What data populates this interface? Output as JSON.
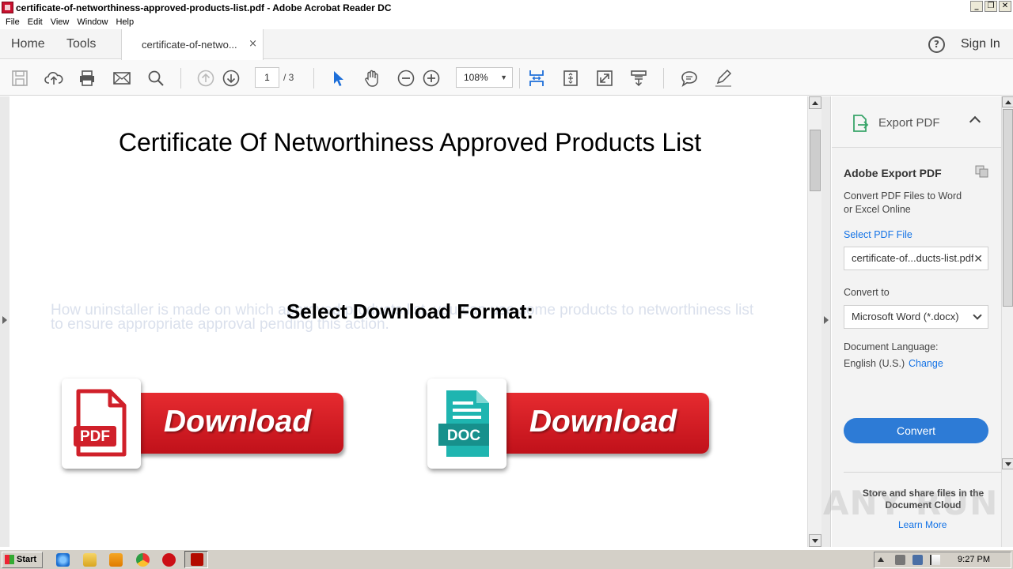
{
  "window": {
    "title": "certificate-of-networthiness-approved-products-list.pdf - Adobe Acrobat Reader DC",
    "buttons": [
      "_",
      "❐",
      "✕"
    ]
  },
  "menu": [
    "File",
    "Edit",
    "View",
    "Window",
    "Help"
  ],
  "tabs": {
    "home": "Home",
    "tools": "Tools",
    "document": "certificate-of-netwo...",
    "close": "×",
    "help": "?",
    "sign_in": "Sign In"
  },
  "toolbar": {
    "page_current": "1",
    "page_total": "/ 3",
    "zoom": "108%",
    "icons": [
      "save-icon",
      "upload-icon",
      "print-icon",
      "email-icon",
      "search-icon",
      "page-up-icon",
      "page-down-icon",
      "select-cursor-icon",
      "hand-icon",
      "zoom-out-icon",
      "zoom-in-icon",
      "fit-page-icon",
      "full-screen-icon",
      "read-mode-icon",
      "scroll-mode-icon",
      "comment-icon",
      "sign-icon"
    ]
  },
  "document": {
    "title": "Certificate Of Networthiness Approved Products List",
    "background_text": "How uninstaller is made on which approved products list, you can use some products to networthiness list to ensure appropriate approval pending this action.",
    "select_format": "Select Download Format:",
    "pdf_button": {
      "badge": "PDF",
      "label": "Download"
    },
    "doc_button": {
      "badge": "DOC",
      "label": "Download"
    }
  },
  "panel": {
    "header": "Export PDF",
    "section_title": "Adobe Export PDF",
    "description": "Convert PDF Files to Word or Excel Online",
    "select_file_label": "Select PDF File",
    "file_value": "certificate-of...ducts-list.pdf",
    "convert_to_label": "Convert to",
    "convert_to_value": "Microsoft Word (*.docx)",
    "doc_language_label": "Document Language:",
    "doc_language_value": "English (U.S.)",
    "change_link": "Change",
    "convert_button": "Convert",
    "footer_text": "Store and share files in the Document Cloud",
    "learn_more": "Learn More"
  },
  "watermark": "ANY RUN",
  "taskbar": {
    "start": "Start",
    "clock": "9:27 PM"
  },
  "colors": {
    "accent_blue": "#2d7bd6",
    "download_red": "#d81e26",
    "pdf_red": "#d0202a",
    "doc_teal": "#1fb5b0"
  }
}
